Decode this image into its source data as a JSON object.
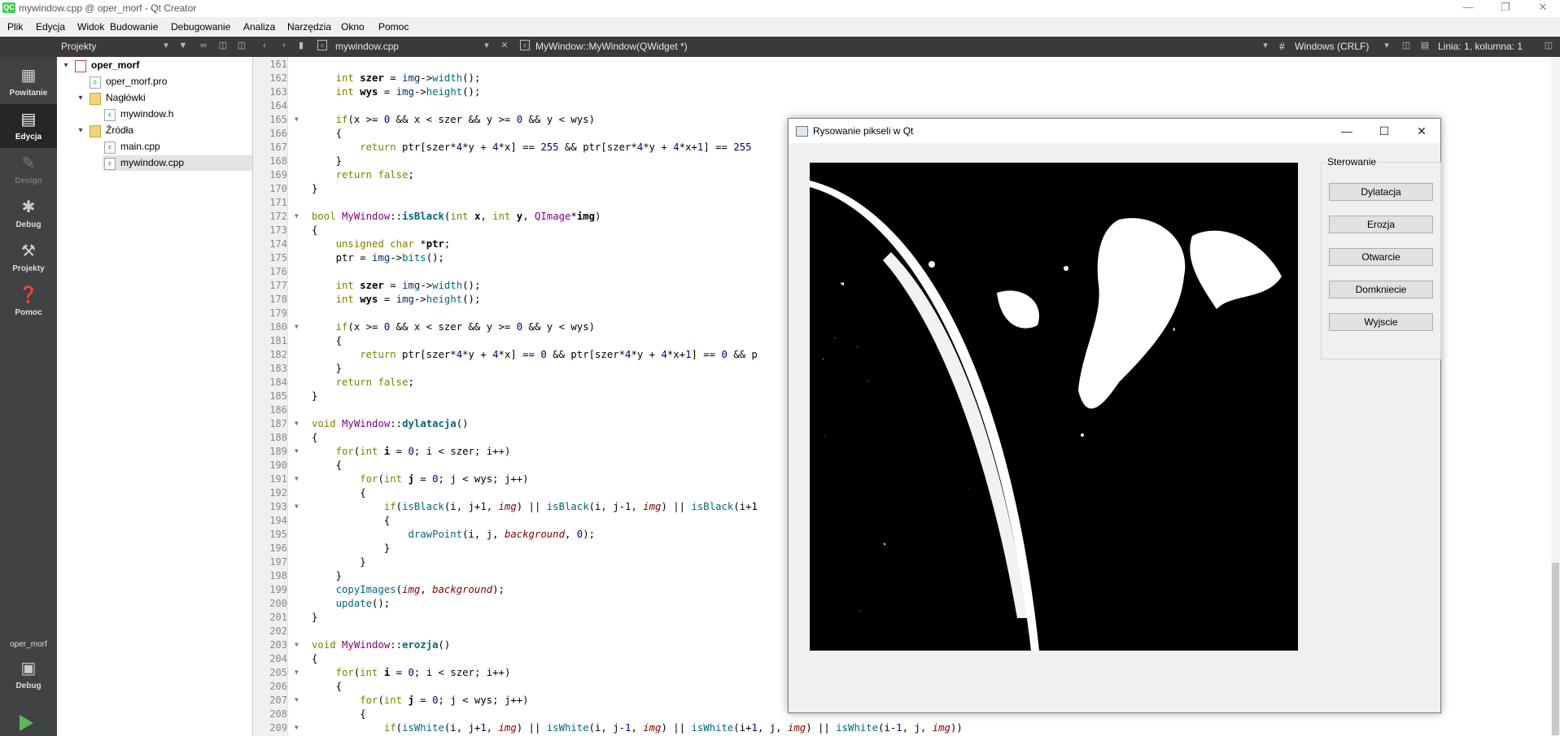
{
  "window": {
    "title": "mywindow.cpp @ oper_morf - Qt Creator",
    "logo": "QC"
  },
  "menu": [
    "Plik",
    "Edycja",
    "Widok",
    "Budowanie",
    "Debugowanie",
    "Analiza",
    "Narzędzia",
    "Okno",
    "Pomoc"
  ],
  "toolbar": {
    "projects_combo": "Projekty",
    "file_tab": "mywindow.cpp",
    "symbol": "MyWindow::MyWindow(QWidget *)",
    "hash": "#",
    "line_ending": "Windows (CRLF)",
    "cursor_pos": "Linia: 1, kolumna: 1"
  },
  "modes": [
    {
      "label": "Powitanie",
      "icon": "grid-icon"
    },
    {
      "label": "Edycja",
      "icon": "edit-doc-icon"
    },
    {
      "label": "Design",
      "icon": "pencil-icon"
    },
    {
      "label": "Debug",
      "icon": "bug-icon"
    },
    {
      "label": "Projekty",
      "icon": "wrench-icon"
    },
    {
      "label": "Pomoc",
      "icon": "help-icon"
    }
  ],
  "kit": {
    "project": "oper_morf",
    "label": "Debug",
    "icon": "monitor-icon"
  },
  "tree": [
    {
      "label": "oper_morf",
      "level": 0,
      "arrow": "▾",
      "icon": "proj",
      "bold": true
    },
    {
      "label": "oper_morf.pro",
      "level": 1,
      "arrow": "",
      "icon": "file"
    },
    {
      "label": "Nagłówki",
      "level": 1,
      "arrow": "▾",
      "icon": "folder"
    },
    {
      "label": "mywindow.h",
      "level": 2,
      "arrow": "",
      "icon": "file"
    },
    {
      "label": "Źródła",
      "level": 1,
      "arrow": "▾",
      "icon": "folder"
    },
    {
      "label": "main.cpp",
      "level": 2,
      "arrow": "",
      "icon": "file"
    },
    {
      "label": "mywindow.cpp",
      "level": 2,
      "arrow": "",
      "icon": "file",
      "selected": true
    }
  ],
  "code": [
    {
      "n": "161",
      "t": ""
    },
    {
      "n": "162",
      "t": "    <span class='kw'>int</span> <span class='bd'>szer</span> = <span class='ch'>img</span>-><span class='fn'>width</span>();"
    },
    {
      "n": "163",
      "t": "    <span class='kw'>int</span> <span class='bd'>wys</span> = <span class='ch'>img</span>-><span class='fn'>height</span>();"
    },
    {
      "n": "164",
      "t": ""
    },
    {
      "n": "165",
      "f": 1,
      "t": "    <span class='kw'>if</span>(x >= <span class='nm'>0</span> && x < szer && y >= <span class='nm'>0</span> && y < wys)"
    },
    {
      "n": "166",
      "t": "    {"
    },
    {
      "n": "167",
      "t": "        <span class='kw'>return</span> ptr[szer*<span class='nm'>4</span>*y + <span class='nm'>4</span>*x] == <span class='nm'>255</span> && ptr[szer*<span class='nm'>4</span>*y + <span class='nm'>4</span>*x+<span class='nm'>1</span>] == <span class='nm'>255</span>"
    },
    {
      "n": "168",
      "t": "    }"
    },
    {
      "n": "169",
      "t": "    <span class='kw'>return</span> <span class='kw'>false</span>;"
    },
    {
      "n": "170",
      "t": "}"
    },
    {
      "n": "171",
      "t": ""
    },
    {
      "n": "172",
      "f": 1,
      "t": "<span class='kw'>bool</span> <span class='ty'>MyWindow</span>::<span class='fn bd'>isBlack</span>(<span class='kw'>int</span> <span class='bd'>x</span>, <span class='kw'>int</span> <span class='bd'>y</span>, <span class='ty'>QImage</span>*<span class='bd'>img</span>)"
    },
    {
      "n": "173",
      "t": "{"
    },
    {
      "n": "174",
      "t": "    <span class='kw'>unsigned</span> <span class='kw'>char</span> *<span class='bd'>ptr</span>;"
    },
    {
      "n": "175",
      "t": "    ptr = <span class='ch'>img</span>-><span class='fn'>bits</span>();"
    },
    {
      "n": "176",
      "t": ""
    },
    {
      "n": "177",
      "t": "    <span class='kw'>int</span> <span class='bd'>szer</span> = <span class='ch'>img</span>-><span class='fn'>width</span>();"
    },
    {
      "n": "178",
      "t": "    <span class='kw'>int</span> <span class='bd'>wys</span> = <span class='ch'>img</span>-><span class='fn'>height</span>();"
    },
    {
      "n": "179",
      "t": ""
    },
    {
      "n": "180",
      "f": 1,
      "t": "    <span class='kw'>if</span>(x >= <span class='nm'>0</span> && x < szer && y >= <span class='nm'>0</span> && y < wys)"
    },
    {
      "n": "181",
      "t": "    {"
    },
    {
      "n": "182",
      "t": "        <span class='kw'>return</span> ptr[szer*<span class='nm'>4</span>*y + <span class='nm'>4</span>*x] == <span class='nm'>0</span> && ptr[szer*<span class='nm'>4</span>*y + <span class='nm'>4</span>*x+<span class='nm'>1</span>] == <span class='nm'>0</span> && p"
    },
    {
      "n": "183",
      "t": "    }"
    },
    {
      "n": "184",
      "t": "    <span class='kw'>return</span> <span class='kw'>false</span>;"
    },
    {
      "n": "185",
      "t": "}"
    },
    {
      "n": "186",
      "t": ""
    },
    {
      "n": "187",
      "f": 1,
      "t": "<span class='kw'>void</span> <span class='ty'>MyWindow</span>::<span class='fn bd'>dylatacja</span>()"
    },
    {
      "n": "188",
      "t": "{"
    },
    {
      "n": "189",
      "f": 1,
      "t": "    <span class='kw'>for</span>(<span class='kw'>int</span> <span class='bd'>i</span> = <span class='nm'>0</span>; i < szer; i++)"
    },
    {
      "n": "190",
      "t": "    {"
    },
    {
      "n": "191",
      "f": 1,
      "t": "        <span class='kw'>for</span>(<span class='kw'>int</span> <span class='bd'>j</span> = <span class='nm'>0</span>; j < wys; j++)"
    },
    {
      "n": "192",
      "t": "        {"
    },
    {
      "n": "193",
      "f": 1,
      "t": "            <span class='kw'>if</span>(<span class='fn'>isBlack</span>(i, j+<span class='nm'>1</span>, <span class='it'>img</span>) || <span class='fn'>isBlack</span>(i, j-<span class='nm'>1</span>, <span class='it'>img</span>) || <span class='fn'>isBlack</span>(i+1"
    },
    {
      "n": "194",
      "t": "            {"
    },
    {
      "n": "195",
      "t": "                <span class='fn'>drawPoint</span>(i, j, <span class='it'>background</span>, <span class='nm'>0</span>);"
    },
    {
      "n": "196",
      "t": "            }"
    },
    {
      "n": "197",
      "t": "        }"
    },
    {
      "n": "198",
      "t": "    }"
    },
    {
      "n": "199",
      "t": "    <span class='fn'>copyImages</span>(<span class='it'>img</span>, <span class='it'>background</span>);"
    },
    {
      "n": "200",
      "t": "    <span class='fn'>update</span>();"
    },
    {
      "n": "201",
      "t": "}"
    },
    {
      "n": "202",
      "t": ""
    },
    {
      "n": "203",
      "f": 1,
      "t": "<span class='kw'>void</span> <span class='ty'>MyWindow</span>::<span class='fn bd'>erozja</span>()"
    },
    {
      "n": "204",
      "t": "{"
    },
    {
      "n": "205",
      "f": 1,
      "t": "    <span class='kw'>for</span>(<span class='kw'>int</span> <span class='bd'>i</span> = <span class='nm'>0</span>; i < szer; i++)"
    },
    {
      "n": "206",
      "t": "    {"
    },
    {
      "n": "207",
      "f": 1,
      "t": "        <span class='kw'>for</span>(<span class='kw'>int</span> <span class='bd'>j</span> = <span class='nm'>0</span>; j < wys; j++)"
    },
    {
      "n": "208",
      "t": "        {"
    },
    {
      "n": "209",
      "f": 1,
      "t": "            <span class='kw'>if</span>(<span class='fn'>isWhite</span>(i, j+<span class='nm'>1</span>, <span class='it'>img</span>) || <span class='fn'>isWhite</span>(i, j-<span class='nm'>1</span>, <span class='it'>img</span>) || <span class='fn'>isWhite</span>(i+<span class='nm'>1</span>, j, <span class='it'>img</span>) || <span class='fn'>isWhite</span>(i-<span class='nm'>1</span>, j, <span class='it'>img</span>))"
    }
  ],
  "dialog": {
    "title": "Rysowanie pikseli w Qt",
    "group_label": "Sterowanie",
    "buttons": [
      "Dylatacja",
      "Erozja",
      "Otwarcie",
      "Domkniecie",
      "Wyjscie"
    ]
  },
  "colors": {
    "modebar": "#404244",
    "toolbar": "#3a3a3a",
    "keyword": "#808000",
    "type": "#800080",
    "function": "#00677c",
    "number": "#000080"
  }
}
